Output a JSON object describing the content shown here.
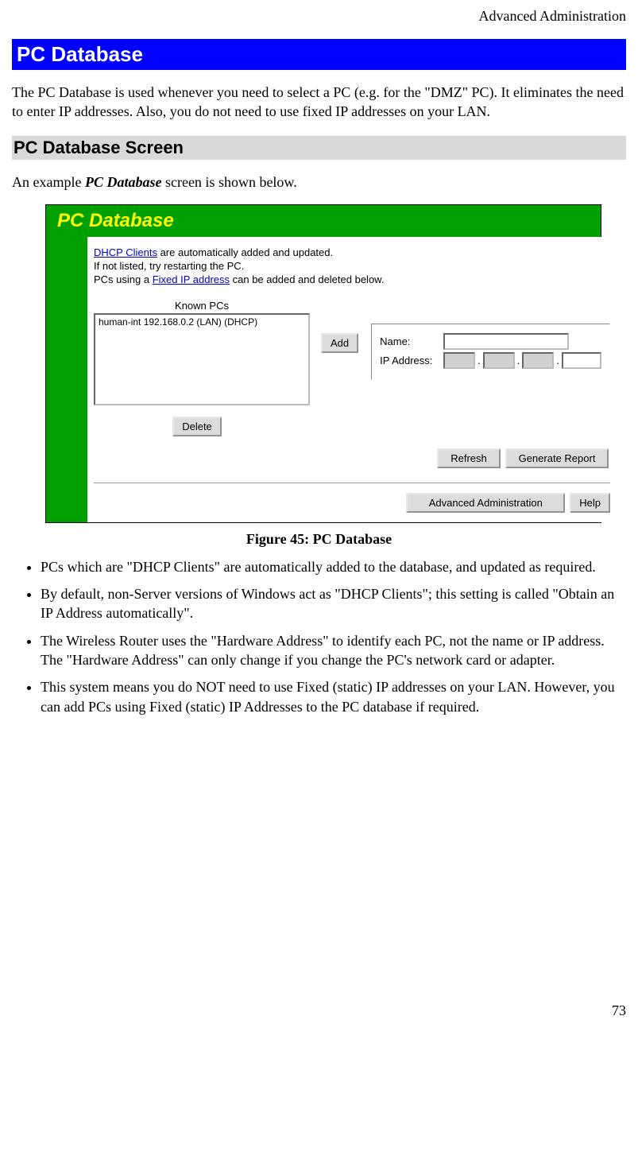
{
  "header": {
    "section": "Advanced Administration"
  },
  "title": "PC Database",
  "intro": "The PC Database is used whenever you need to select a PC (e.g. for the \"DMZ\" PC). It eliminates the need to enter IP addresses. Also, you do not need to use fixed IP addresses on your LAN.",
  "subhead": "PC Database Screen",
  "example_lead": "An example ",
  "example_em": "PC Database",
  "example_tail": " screen is shown below.",
  "figure_caption": "Figure 45: PC Database",
  "bullets": [
    "PCs which are \"DHCP Clients\" are automatically added to the database, and updated as required.",
    "By default, non-Server versions of Windows act as \"DHCP Clients\"; this setting is called \"Obtain an IP Address automatically\".",
    "The Wireless Router uses the \"Hardware Address\" to identify each PC, not the name or IP address. The \"Hardware Address\" can only change if you change the PC's network card or adapter.",
    "This system means you do NOT need to use Fixed (static) IP addresses on your LAN. However, you can add PCs using Fixed (static) IP Addresses to the PC database if required."
  ],
  "page_number": "73",
  "ui": {
    "banner_title": "PC Database",
    "note1_link": "DHCP Clients",
    "note1_rest": " are automatically added and updated.",
    "note2": "If not listed, try restarting the PC.",
    "note3_pre": "PCs using a ",
    "note3_link": "Fixed IP address",
    "note3_post": " can be added and deleted below.",
    "known_label": "Known PCs",
    "list_entry": "human-int 192.168.0.2 (LAN) (DHCP)",
    "btn_add": "Add",
    "btn_delete": "Delete",
    "name_label": "Name:",
    "ip_label": "IP Address:",
    "btn_refresh": "Refresh",
    "btn_report": "Generate Report",
    "btn_advadmin": "Advanced Administration",
    "btn_help": "Help"
  }
}
